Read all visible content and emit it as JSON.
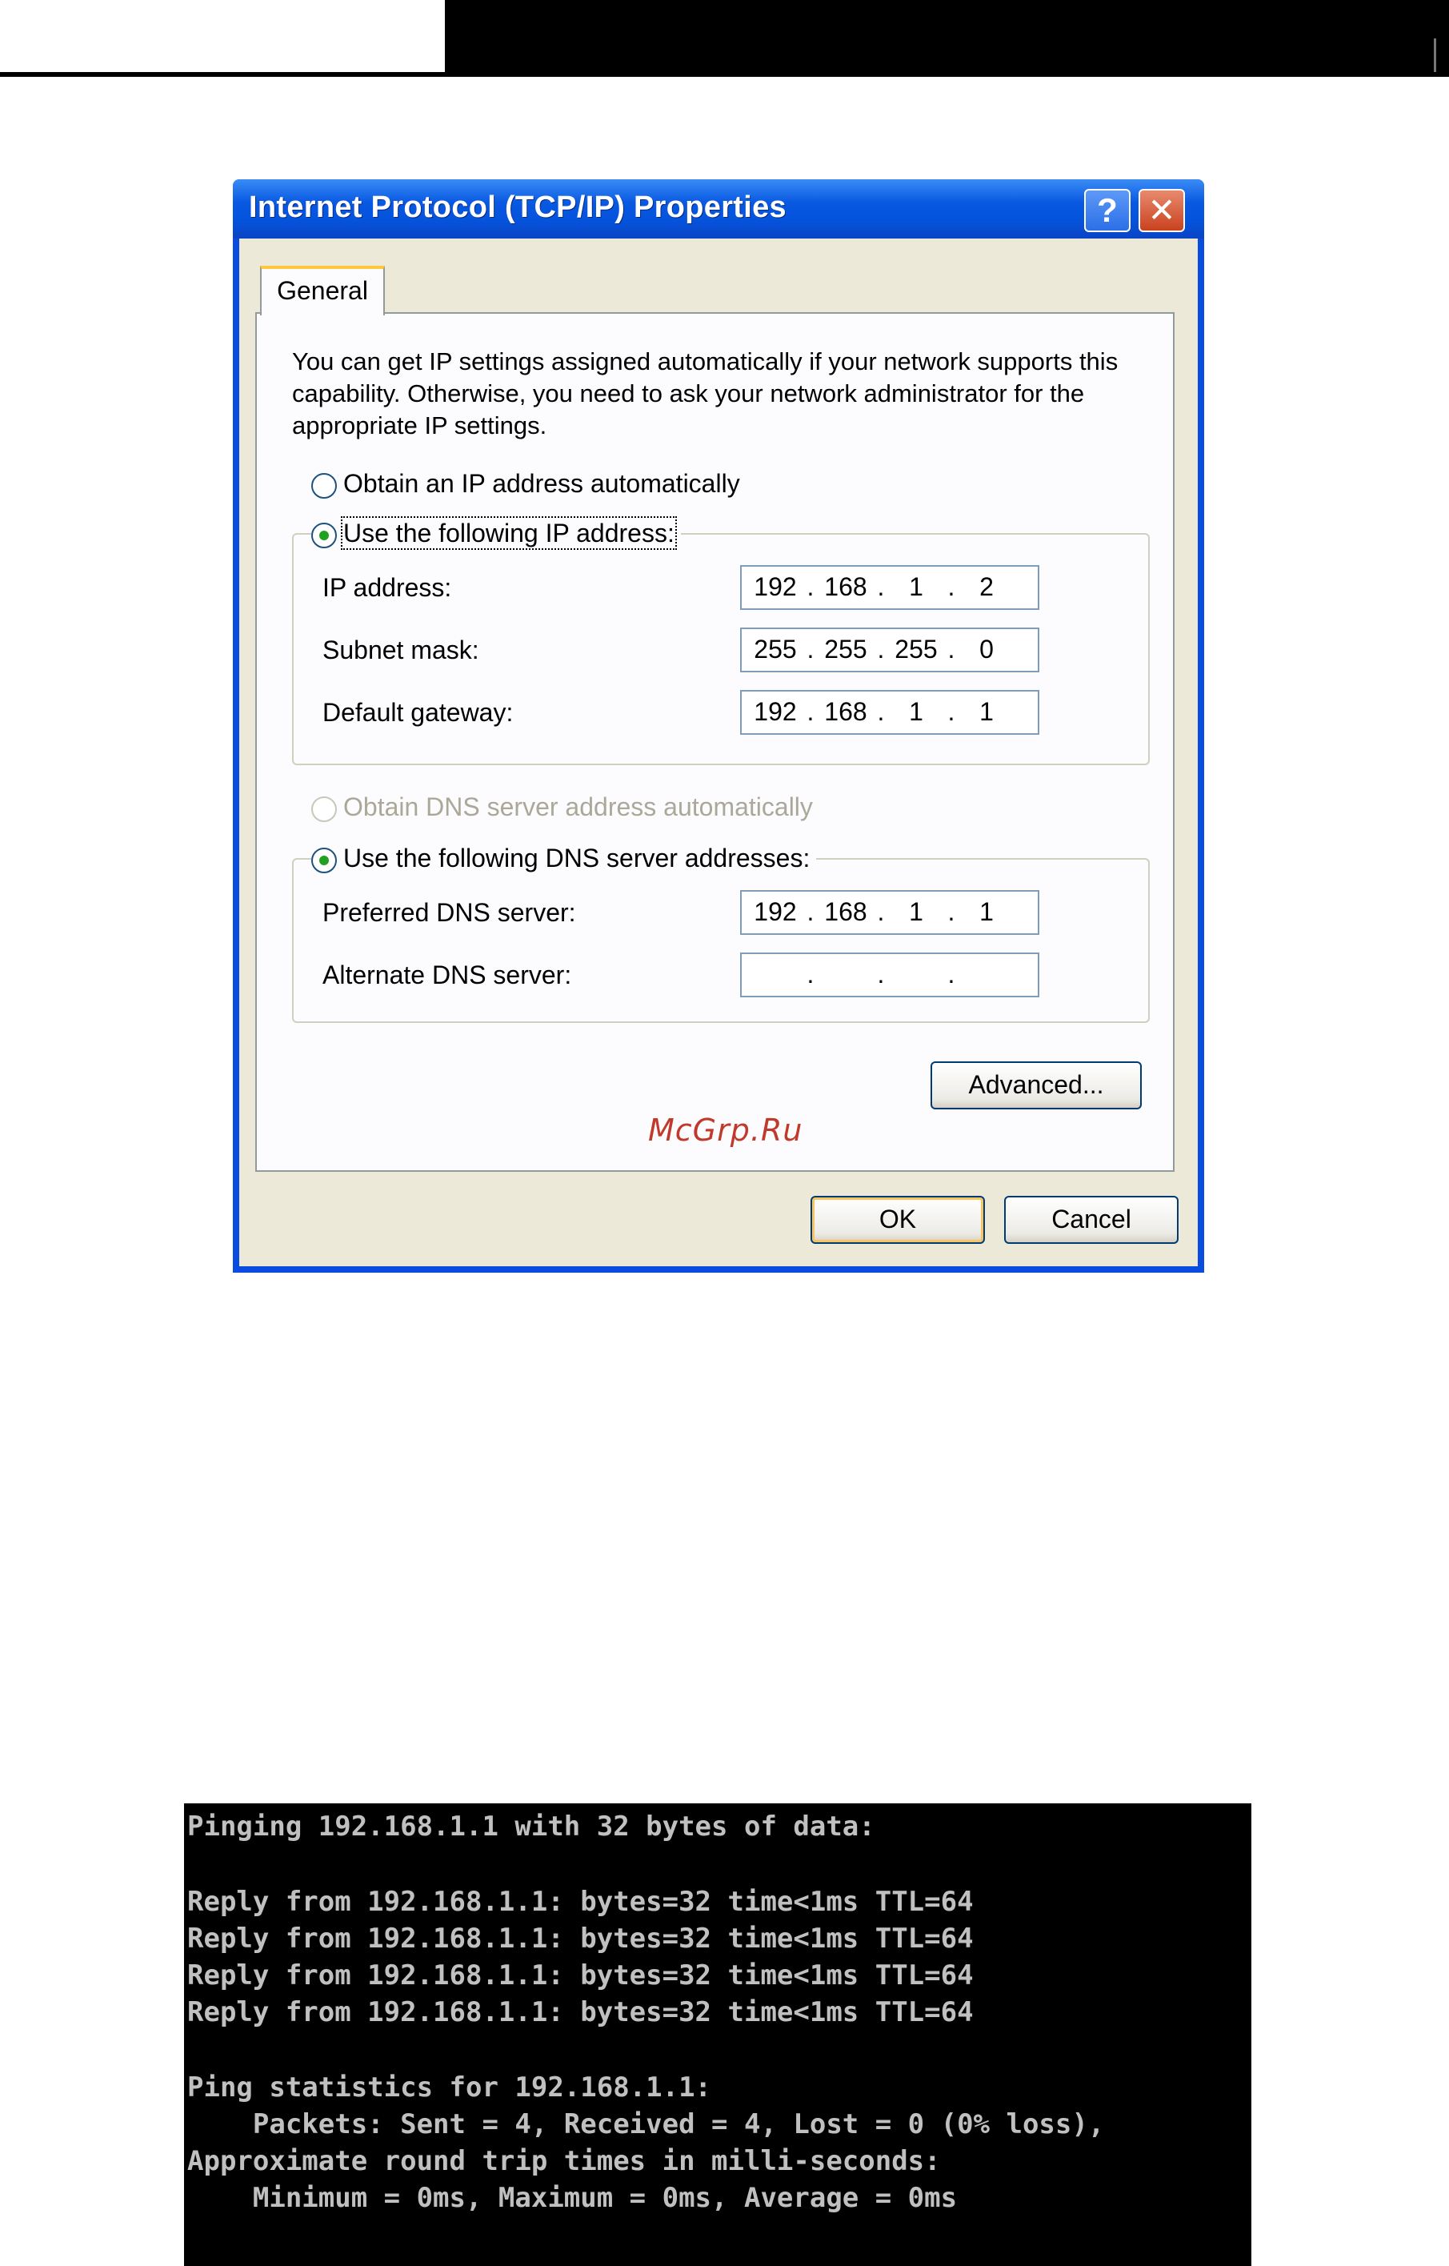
{
  "dialog": {
    "title": "Internet Protocol (TCP/IP) Properties",
    "help_label": "?",
    "close_label": "✕",
    "tab_general": "General",
    "intro": "You can get IP settings assigned automatically if your network supports this capability. Otherwise, you need to ask your network administrator for the appropriate IP settings.",
    "ip_auto": "Obtain an IP address automatically",
    "ip_manual": "Use the following IP address:",
    "ip_label": "IP address:",
    "ip_value": [
      "192",
      "168",
      "1",
      "2"
    ],
    "mask_label": "Subnet mask:",
    "mask_value": [
      "255",
      "255",
      "255",
      "0"
    ],
    "gateway_label": "Default gateway:",
    "gateway_value": [
      "192",
      "168",
      "1",
      "1"
    ],
    "dns_auto": "Obtain DNS server address automatically",
    "dns_manual": "Use the following DNS server addresses:",
    "dns_pref_label": "Preferred DNS server:",
    "dns_pref_value": [
      "192",
      "168",
      "1",
      "1"
    ],
    "dns_alt_label": "Alternate DNS server:",
    "dns_alt_value": [
      "",
      "",
      "",
      ""
    ],
    "advanced_label": "Advanced...",
    "ok_label": "OK",
    "cancel_label": "Cancel"
  },
  "watermark": "McGrp.Ru",
  "console": {
    "lines": [
      "Pinging 192.168.1.1 with 32 bytes of data:",
      "",
      "Reply from 192.168.1.1: bytes=32 time<1ms TTL=64",
      "Reply from 192.168.1.1: bytes=32 time<1ms TTL=64",
      "Reply from 192.168.1.1: bytes=32 time<1ms TTL=64",
      "Reply from 192.168.1.1: bytes=32 time<1ms TTL=64",
      "",
      "Ping statistics for 192.168.1.1:",
      "    Packets: Sent = 4, Received = 4, Lost = 0 (0% loss),",
      "Approximate round trip times in milli-seconds:",
      "    Minimum = 0ms, Maximum = 0ms, Average = 0ms"
    ]
  }
}
